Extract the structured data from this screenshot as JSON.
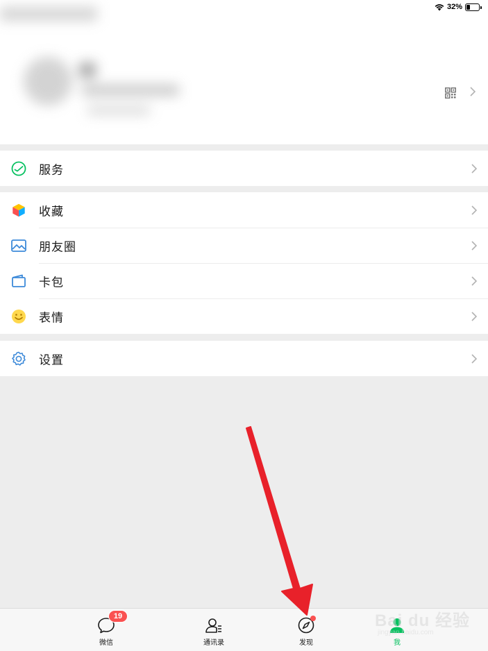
{
  "status_bar": {
    "battery": "32%",
    "battery_level": 0.32
  },
  "menu": {
    "service": "服务",
    "favorites": "收藏",
    "moments": "朋友圈",
    "cards": "卡包",
    "stickers": "表情",
    "settings": "设置"
  },
  "tabbar": {
    "tabs": [
      {
        "label": "微信",
        "badge": "19"
      },
      {
        "label": "通讯录"
      },
      {
        "label": "发现"
      },
      {
        "label": "我"
      }
    ]
  },
  "watermark": {
    "brand": "Bai du 经验",
    "url": "jingyan.baidu.com"
  },
  "colors": {
    "accent": "#07c160",
    "badge": "#fa5151",
    "arrow": "#e8212a",
    "background": "#ededed"
  }
}
